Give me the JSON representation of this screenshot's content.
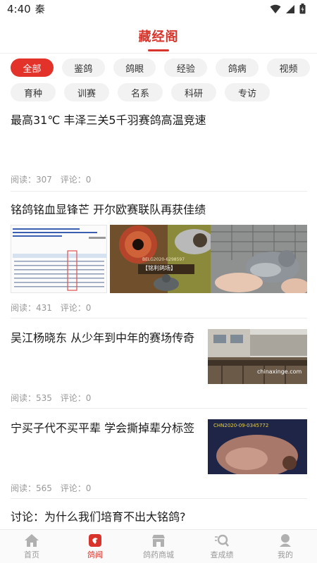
{
  "status": {
    "time": "4:40",
    "carrier": "秦"
  },
  "header": {
    "title": "藏经阁"
  },
  "categories": {
    "row1": [
      "全部",
      "鉴鸽",
      "鸽眼",
      "经验",
      "鸽病",
      "视频"
    ],
    "row2": [
      "育种",
      "训赛",
      "名系",
      "科研",
      "专访"
    ],
    "active": "全部"
  },
  "articles": [
    {
      "title": "最高31℃ 丰泽三关5千羽赛鸽高温竞速",
      "reads_label": "阅读：307",
      "comments_label": "评论：0"
    },
    {
      "title": "铭鸽铭血显锋芒 开尔欧赛联队再获佳绩",
      "reads_label": "阅读：431",
      "comments_label": "评论：0",
      "watermark": "【铭利鸽场】",
      "ring_text": "BELG2020-6298597"
    },
    {
      "title": "吴江杨晓东 从少年到中年的赛场传奇",
      "reads_label": "阅读：535",
      "comments_label": "评论：0",
      "watermark": "chinaxinge.com"
    },
    {
      "title": "宁买子代不买平辈 学会撕掉辈分标签",
      "reads_label": "阅读：565",
      "comments_label": "评论：0",
      "ring_text": "CHN2020-09-0345772"
    },
    {
      "title": "讨论：为什么我们培育不出大铭鸽?"
    }
  ],
  "nav": [
    {
      "label": "首页",
      "icon": "home-icon"
    },
    {
      "label": "鸽闻",
      "icon": "news-icon",
      "active": true
    },
    {
      "label": "鸽药商城",
      "icon": "store-icon"
    },
    {
      "label": "查成绩",
      "icon": "search-results-icon"
    },
    {
      "label": "我的",
      "icon": "profile-icon"
    }
  ],
  "colors": {
    "accent": "#d9342b",
    "chip_bg": "#f2f2f2",
    "meta": "#999999"
  }
}
